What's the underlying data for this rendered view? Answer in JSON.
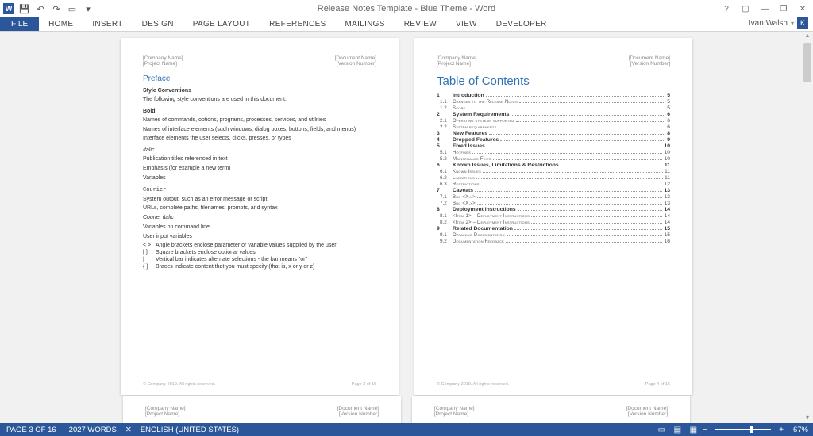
{
  "title": "Release Notes Template - Blue Theme - Word",
  "user": "Ivan Walsh",
  "user_initial": "K",
  "qat": {
    "save": "💾",
    "undo": "↶",
    "redo": "↷",
    "touch": "▭"
  },
  "win": {
    "help": "?",
    "ribbon": "▢",
    "min": "—",
    "restore": "❐",
    "close": "✕"
  },
  "tabs": {
    "file": "FILE",
    "home": "HOME",
    "insert": "INSERT",
    "design": "DESIGN",
    "page_layout": "PAGE LAYOUT",
    "references": "REFERENCES",
    "mailings": "MAILINGS",
    "review": "REVIEW",
    "view": "VIEW",
    "developer": "DEVELOPER"
  },
  "header": {
    "left1": "[Company Name]",
    "left2": "[Project Name]",
    "right1": "[Document Name]",
    "right2": "[Version Number]"
  },
  "footer": {
    "left": "© Company 2019. All rights reserved.",
    "right_p3": "Page 3 of 16",
    "right_p4": "Page 4 of 16"
  },
  "preface": {
    "title": "Preface",
    "style_conv": "Style Conventions",
    "intro": "The following style conventions are used in this document:",
    "bold": "Bold",
    "b1": "Names of commands, options, programs, processes, services, and utilities",
    "b2": "Names of interface elements (such windows, dialog boxes, buttons, fields, and menus)",
    "b3": "Interface elements the user selects, clicks, presses, or types",
    "italic": "Italic",
    "i1": "Publication titles referenced in text",
    "i2": "Emphasis (for example a new term)",
    "i3": "Variables",
    "courier": "Courier",
    "c1": "System output, such as an error message or script",
    "c2": "URLs, complete paths, filenames, prompts, and syntax",
    "courier_italic": "Courier italic",
    "ci1": "Variables on command line",
    "ci2": "User input variables",
    "sym_ab": "< >",
    "sym_ab_txt": "Angle brackets enclose parameter or variable values supplied by the user",
    "sym_sq": "[ ]",
    "sym_sq_txt": "Square brackets enclose optional values",
    "sym_pipe": "|",
    "sym_pipe_txt": "Vertical bar indicates alternate selections - the bar means \"or\"",
    "sym_brace": "{ }",
    "sym_brace_txt": "Braces indicate content that you must specify (that is, x or y or z)"
  },
  "toc": {
    "title": "Table of Contents",
    "rows": [
      {
        "n": "1",
        "t": "Introduction",
        "p": "5",
        "m": true
      },
      {
        "n": "1.1",
        "t": "Changes to the Release Notes",
        "p": "5"
      },
      {
        "n": "1.2",
        "t": "Scope",
        "p": "5"
      },
      {
        "n": "2",
        "t": "System Requirements",
        "p": "6",
        "m": true
      },
      {
        "n": "2.1",
        "t": "Operating systems supported",
        "p": "6"
      },
      {
        "n": "2.2",
        "t": "System requirements",
        "p": "6"
      },
      {
        "n": "3",
        "t": "New Features",
        "p": "8",
        "m": true
      },
      {
        "n": "4",
        "t": "Dropped Features",
        "p": "9",
        "m": true
      },
      {
        "n": "5",
        "t": "Fixed Issues",
        "p": "10",
        "m": true
      },
      {
        "n": "5.1",
        "t": "Hotfixes",
        "p": "10"
      },
      {
        "n": "5.2",
        "t": "Maintenance Fixes",
        "p": "10"
      },
      {
        "n": "6",
        "t": "Known Issues, Limitations & Restrictions",
        "p": "11",
        "m": true
      },
      {
        "n": "6.1",
        "t": "Known Issues",
        "p": "11"
      },
      {
        "n": "6.2",
        "t": "Limitations",
        "p": "11"
      },
      {
        "n": "6.3",
        "t": "Restrictions",
        "p": "12"
      },
      {
        "n": "7",
        "t": "Caveats",
        "p": "13",
        "m": true
      },
      {
        "n": "7.1",
        "t": "Bug <X.x>",
        "p": "13"
      },
      {
        "n": "7.2",
        "t": "Bug <X.x>",
        "p": "13"
      },
      {
        "n": "8",
        "t": "Deployment Instructions",
        "p": "14",
        "m": true
      },
      {
        "n": "8.1",
        "t": "<Item 1> – Deployment Instructions",
        "p": "14"
      },
      {
        "n": "8.2",
        "t": "<Item 2> – Deployment Instructions",
        "p": "14"
      },
      {
        "n": "9",
        "t": "Related Documentation",
        "p": "15",
        "m": true
      },
      {
        "n": "9.1",
        "t": "Obtaining Documentation",
        "p": "15"
      },
      {
        "n": "9.2",
        "t": "Documentation Feedback",
        "p": "16"
      }
    ]
  },
  "status": {
    "page": "PAGE 3 OF 16",
    "words": "2027 WORDS",
    "lang": "ENGLISH (UNITED STATES)",
    "zoom": "67%",
    "minus": "−",
    "plus": "+"
  }
}
